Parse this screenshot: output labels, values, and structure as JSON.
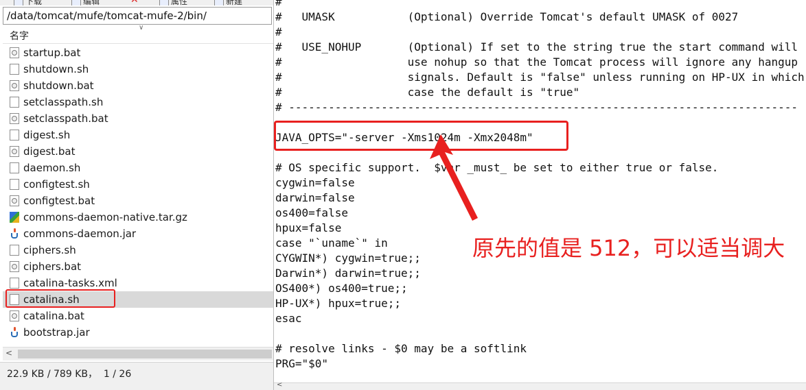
{
  "toolbar": {
    "items": [
      "下载",
      "编辑",
      "属性",
      "新建"
    ]
  },
  "left_pane": {
    "path": "/data/tomcat/mufe/tomcat-mufe-2/bin/",
    "column_header": "名字",
    "files": [
      {
        "name": "startup.bat",
        "icon": "bat-file-icon"
      },
      {
        "name": "shutdown.sh",
        "icon": "file-icon"
      },
      {
        "name": "shutdown.bat",
        "icon": "bat-file-icon"
      },
      {
        "name": "setclasspath.sh",
        "icon": "file-icon"
      },
      {
        "name": "setclasspath.bat",
        "icon": "bat-file-icon"
      },
      {
        "name": "digest.sh",
        "icon": "file-icon"
      },
      {
        "name": "digest.bat",
        "icon": "bat-file-icon"
      },
      {
        "name": "daemon.sh",
        "icon": "file-icon"
      },
      {
        "name": "configtest.sh",
        "icon": "file-icon"
      },
      {
        "name": "configtest.bat",
        "icon": "bat-file-icon"
      },
      {
        "name": "commons-daemon-native.tar.gz",
        "icon": "archive-icon"
      },
      {
        "name": "commons-daemon.jar",
        "icon": "jar-icon"
      },
      {
        "name": "ciphers.sh",
        "icon": "file-icon"
      },
      {
        "name": "ciphers.bat",
        "icon": "bat-file-icon"
      },
      {
        "name": "catalina-tasks.xml",
        "icon": "file-icon"
      },
      {
        "name": "catalina.sh",
        "icon": "file-icon",
        "selected": true
      },
      {
        "name": "catalina.bat",
        "icon": "bat-file-icon"
      },
      {
        "name": "bootstrap.jar",
        "icon": "jar-icon"
      }
    ],
    "status": "22.9 KB / 789 KB，  1 / 26"
  },
  "editor": {
    "lines": [
      "#",
      "#   UMASK           (Optional) Override Tomcat's default UMASK of 0027",
      "#",
      "#   USE_NOHUP       (Optional) If set to the string true the start command will",
      "#                   use nohup so that the Tomcat process will ignore any hangup",
      "#                   signals. Default is \"false\" unless running on HP-UX in which",
      "#                   case the default is \"true\"",
      "# -----------------------------------------------------------------------------",
      "",
      "JAVA_OPTS=\"-server -Xms1024m -Xmx2048m\"",
      "",
      "# OS specific support.  $var _must_ be set to either true or false.",
      "cygwin=false",
      "darwin=false",
      "os400=false",
      "hpux=false",
      "case \"`uname`\" in",
      "CYGWIN*) cygwin=true;;",
      "Darwin*) darwin=true;;",
      "OS400*) os400=true;;",
      "HP-UX*) hpux=true;;",
      "esac",
      "",
      "# resolve links - $0 may be a softlink",
      "PRG=\"$0\""
    ]
  },
  "annotation": {
    "text": "原先的值是 512，可以适当调大",
    "color": "#e8201f"
  }
}
